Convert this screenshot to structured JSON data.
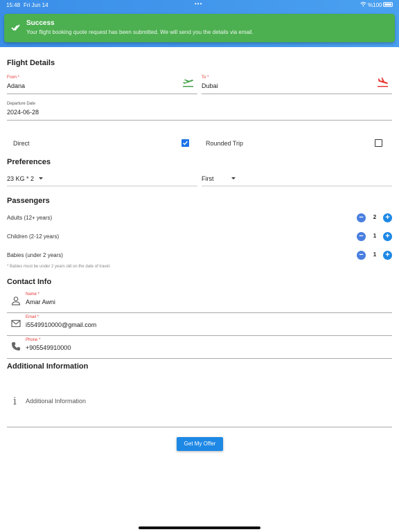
{
  "status_bar": {
    "time": "15:48",
    "date": "Fri Jun 14",
    "battery": "%100"
  },
  "toast": {
    "title": "Success",
    "message": "Your flight booking quote request has been submitted. We will send you the details via email."
  },
  "flight_details": {
    "title": "Flight Details",
    "from": {
      "label": "From *",
      "value": "Adana"
    },
    "to": {
      "label": "To *",
      "value": "Dubai"
    },
    "departure": {
      "label": "Departure Date",
      "value": "2024-06-28"
    },
    "direct": {
      "label": "Direct",
      "checked": true
    },
    "rounded": {
      "label": "Rounded Trip",
      "checked": false
    }
  },
  "preferences": {
    "title": "Preferences",
    "baggage": "23 KG * 2",
    "cabin_class": "First"
  },
  "passengers": {
    "title": "Passengers",
    "items": [
      {
        "label": "Adults (12+ years)",
        "count": "2"
      },
      {
        "label": "Children (2-12 years)",
        "count": "1"
      },
      {
        "label": "Babies (under 2 years)",
        "count": "1"
      }
    ],
    "note": "* Babies must be under 2 years old on the date of travel."
  },
  "contact": {
    "title": "Contact Info",
    "name": {
      "label": "Name *",
      "value": "Amar Awni"
    },
    "email": {
      "label": "Email *",
      "value": "i5549910000@gmail.com"
    },
    "phone": {
      "label": "Phone *",
      "value": "+905549910000"
    }
  },
  "additional": {
    "title": "Additional Information",
    "placeholder": "Additional Information"
  },
  "submit_label": "Get My Offer",
  "colors": {
    "accent": "#1e88e5",
    "success": "#4caf50",
    "required": "#e53935",
    "from_icon": "#43a047",
    "to_icon": "#e53935"
  }
}
